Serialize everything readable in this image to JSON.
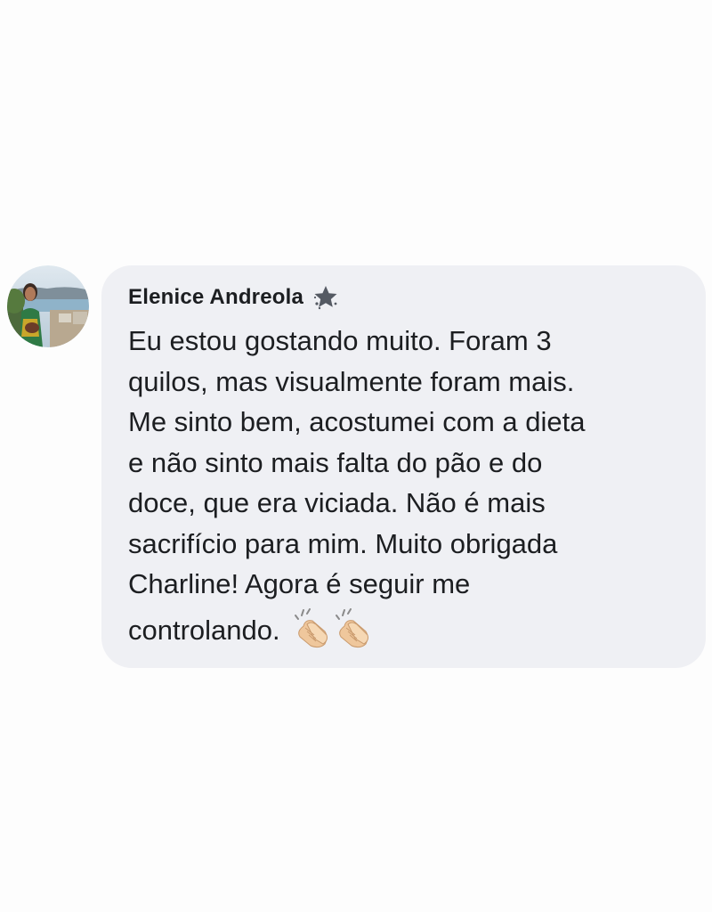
{
  "comment": {
    "author": "Elenice Andreola",
    "badge_icon": "star-badge-icon",
    "avatar_icon": "profile-avatar",
    "text_lines": [
      "Eu estou gostando muito. Foram 3",
      "quilos, mas visualmente foram mais.",
      "Me sinto bem, acostumei com a dieta",
      "e não sinto mais falta do pão e do",
      "doce, que era viciada. Não é mais",
      "sacrifício para mim. Muito obrigada",
      "Charline! Agora é seguir me"
    ],
    "last_line": "controlando.",
    "emoji": [
      "clapping-hands-icon",
      "clapping-hands-icon"
    ],
    "colors": {
      "bubble": "#eff0f4",
      "text": "#1c1e21",
      "background": "#fdfdfd"
    }
  }
}
